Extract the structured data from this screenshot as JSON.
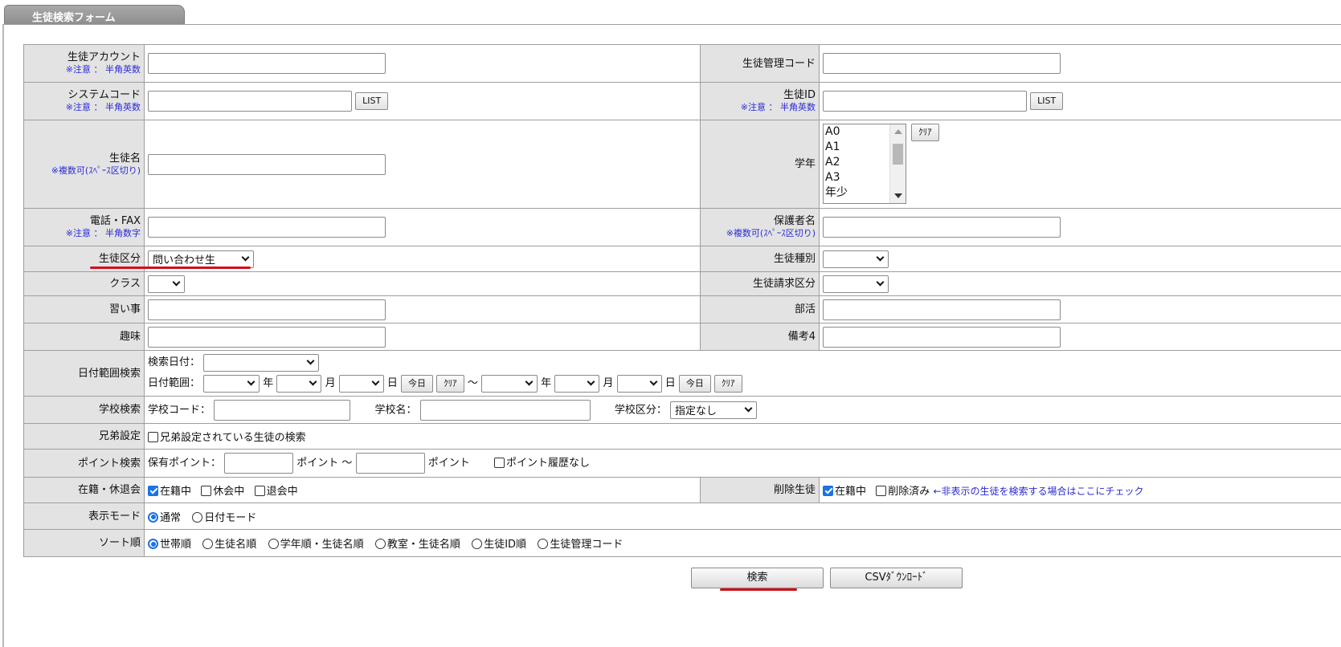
{
  "tab": {
    "title": "生徒検索フォーム"
  },
  "row1": {
    "account_label": "生徒アカウント",
    "account_note": "※注意 ： 半角英数",
    "mgmt_code_label": "生徒管理コード"
  },
  "row2": {
    "system_code_label": "システムコード",
    "system_code_note": "※注意 ： 半角英数",
    "list_label": "LIST",
    "student_id_label": "生徒ID",
    "student_id_note": "※注意 ： 半角英数"
  },
  "row3": {
    "name_label": "生徒名",
    "name_note": "※複数可(ｽﾍﾟｰｽ区切り)",
    "grade_label": "学年",
    "grade_options": [
      "A0",
      "A1",
      "A2",
      "A3",
      "年少"
    ],
    "clear_label": "ｸﾘｱ"
  },
  "row4": {
    "phone_label": "電話・FAX",
    "phone_note": "※注意 ： 半角数字",
    "guardian_label": "保護者名",
    "guardian_note": "※複数可(ｽﾍﾟｰｽ区切り)"
  },
  "row5": {
    "division_label": "生徒区分",
    "division_value": "問い合わせ生",
    "type_label": "生徒種別",
    "type_value": ""
  },
  "row6": {
    "class_label": "クラス",
    "class_value": "",
    "billing_label": "生徒請求区分",
    "billing_value": ""
  },
  "row7": {
    "lesson_label": "習い事",
    "club_label": "部活"
  },
  "row8": {
    "hobby_label": "趣味",
    "remarks_label": "備考4"
  },
  "date_range": {
    "label": "日付範囲検索",
    "search_date_label": "検索日付：",
    "search_date_value": "",
    "range_label": "日付範囲：",
    "year": "年",
    "month": "月",
    "day": "日",
    "today": "今日",
    "clear": "ｸﾘｱ",
    "tilde": "～"
  },
  "school": {
    "label": "学校検索",
    "code_label": "学校コード：",
    "name_label": "学校名：",
    "division_label": "学校区分：",
    "division_value": "指定なし"
  },
  "sibling": {
    "label": "兄弟設定",
    "checkbox_label": "兄弟設定されている生徒の検索",
    "checked": false
  },
  "points": {
    "label": "ポイント検索",
    "owned_label": "保有ポイント：",
    "point_tilde": "ポイント ～",
    "point": "ポイント",
    "no_history_label": "ポイント履歴なし"
  },
  "enrollment": {
    "label": "在籍・休退会",
    "options": [
      {
        "label": "在籍中",
        "checked": true
      },
      {
        "label": "休会中",
        "checked": false
      },
      {
        "label": "退会中",
        "checked": false
      }
    ],
    "deleted_label": "削除生徒",
    "deleted_options": [
      {
        "label": "在籍中",
        "checked": true
      },
      {
        "label": "削除済み",
        "checked": false
      }
    ],
    "deleted_note": "←非表示の生徒を検索する場合はここにチェック"
  },
  "display_mode": {
    "label": "表示モード",
    "options": [
      {
        "label": "通常",
        "selected": true
      },
      {
        "label": "日付モード",
        "selected": false
      }
    ]
  },
  "sort": {
    "label": "ソート順",
    "options": [
      {
        "label": "世帯順",
        "selected": true
      },
      {
        "label": "生徒名順",
        "selected": false
      },
      {
        "label": "学年順・生徒名順",
        "selected": false
      },
      {
        "label": "教室・生徒名順",
        "selected": false
      },
      {
        "label": "生徒ID順",
        "selected": false
      },
      {
        "label": "生徒管理コード",
        "selected": false
      }
    ]
  },
  "actions": {
    "search_label": "検索",
    "csv_label": "CSVﾀﾞｳﾝﾛｰﾄﾞ"
  },
  "colors": {
    "label_bg": "#e3e3e3",
    "note_blue": "#2a2ad6",
    "highlight_red": "#d0101a",
    "accent": "#1a73e8"
  }
}
